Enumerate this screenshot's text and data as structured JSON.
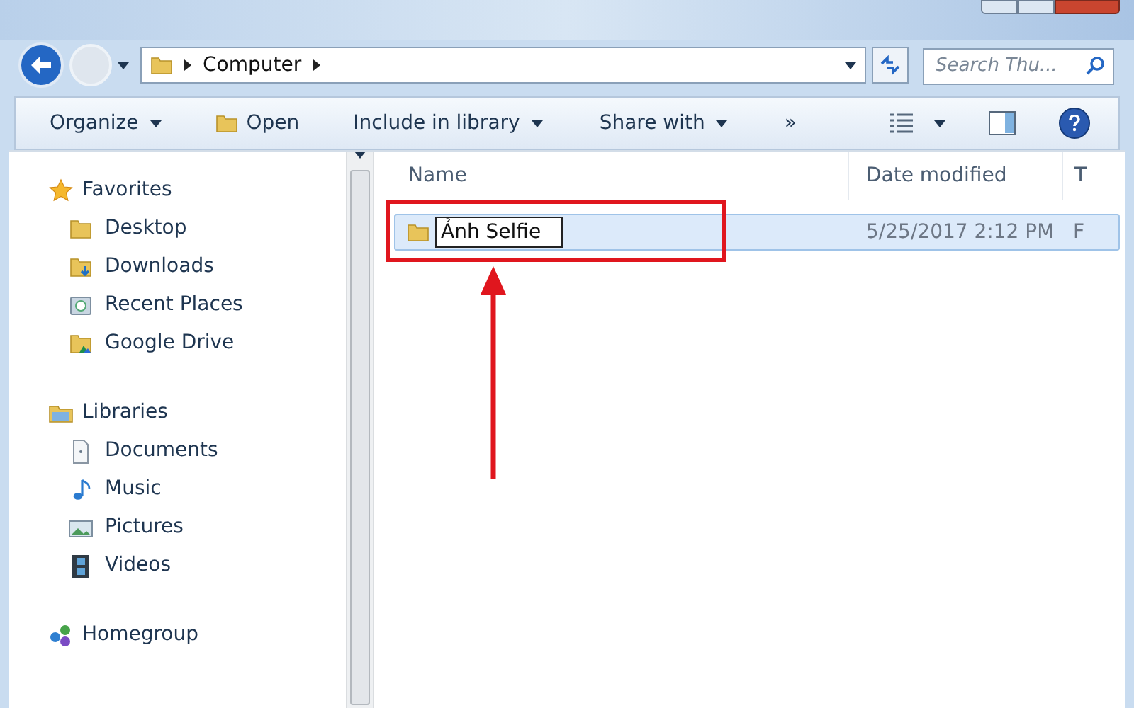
{
  "address_bar": {
    "breadcrumbs": [
      "Computer"
    ]
  },
  "search": {
    "placeholder": "Search Thu..."
  },
  "toolbar": [
    {
      "label": "Organize",
      "kind": "menu"
    },
    {
      "label": "Open",
      "kind": "open"
    },
    {
      "label": "Include in library",
      "kind": "menu"
    },
    {
      "label": "Share with",
      "kind": "menu"
    },
    {
      "label": "»",
      "kind": "more"
    }
  ],
  "navigation": [
    {
      "label": "Favorites",
      "kind": "star",
      "children": [
        {
          "label": "Desktop",
          "kind": "folder"
        },
        {
          "label": "Downloads",
          "kind": "download"
        },
        {
          "label": "Recent Places",
          "kind": "recent"
        },
        {
          "label": "Google Drive",
          "kind": "drive"
        }
      ]
    },
    {
      "label": "Libraries",
      "kind": "library",
      "children": [
        {
          "label": "Documents",
          "kind": "document"
        },
        {
          "label": "Music",
          "kind": "music"
        },
        {
          "label": "Pictures",
          "kind": "picture"
        },
        {
          "label": "Videos",
          "kind": "video"
        }
      ]
    },
    {
      "label": "Homegroup",
      "kind": "homegroup"
    }
  ],
  "file_list": {
    "columns": [
      "Name",
      "Date modified",
      "T"
    ],
    "rows": [
      {
        "name": "Ảnh Selfie",
        "renaming": true,
        "selected": true,
        "date_modified": "5/25/2017 2:12 PM",
        "column_3": "F"
      }
    ]
  }
}
